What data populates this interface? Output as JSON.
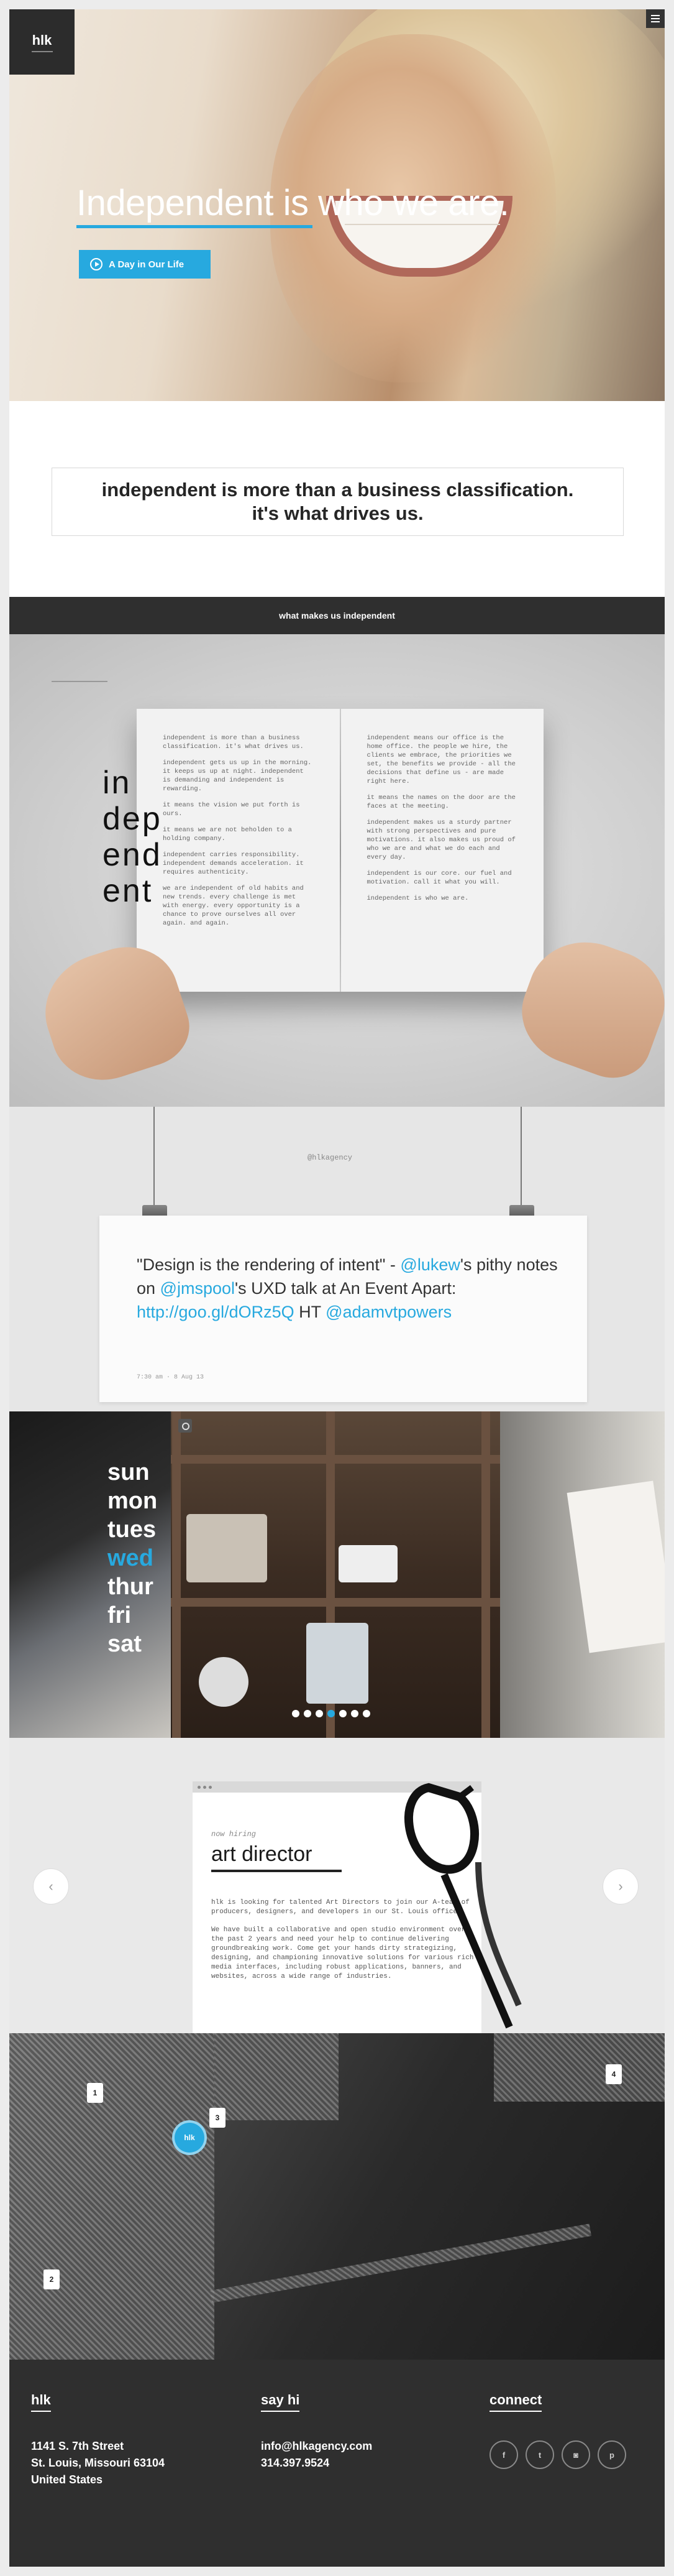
{
  "header": {
    "logo": "hlk",
    "menu_icon": "hamburger-icon"
  },
  "hero": {
    "title": "Independent is who we are.",
    "cta_label": "A Day in Our Life",
    "cta_icon": "play-icon"
  },
  "statement": {
    "line1": "independent is more than a business classification.",
    "line2": "it's what drives us."
  },
  "section_bar": "what makes us independent",
  "book": {
    "big_word": [
      "in",
      "dep",
      "end",
      "ent"
    ],
    "left_page": [
      "independent is more than a business\nclassification. it's what drives us.",
      "independent gets us up in the morning.\nit keeps us up at night. independent\nis demanding and independent is\nrewarding.",
      "it means the vision we put forth is\nours.",
      "it means we are not beholden to a\nholding company.",
      "independent carries responsibility.\nindependent demands acceleration. it\nrequires authenticity.",
      "we are independent of old habits and\nnew trends. every challenge is met\nwith energy. every opportunity is a\nchance to prove ourselves all over\nagain. and again."
    ],
    "right_page": [
      "independent means our office is the\nhome office. the people we hire, the\nclients we embrace, the priorities we\nset, the benefits we provide - all the\ndecisions that define us - are made\nright here.",
      "it means the names on the door are the\nfaces at the meeting.",
      "independent makes us a sturdy partner\nwith strong perspectives and pure\nmotivations. it also makes us proud of\nwho we are and what we do each and\nevery day.",
      "independent is our core. our fuel and\nmotivation. call it what you will.",
      "independent is who we are."
    ]
  },
  "tweet": {
    "handle": "@hlkagency",
    "text_parts": {
      "p1": "\"Design is the rendering of intent\" - ",
      "l1": "@lukew",
      "p2": "'s pithy notes on ",
      "l2": "@jmspool",
      "p3": "'s UXD talk at An Event Apart: ",
      "l3": "http://goo.gl/dORz5Q",
      "p4": "  HT ",
      "l4": "@adamvtpowers"
    },
    "meta": "7:30 am · 8 Aug 13"
  },
  "instagram": {
    "days": [
      "sun",
      "mon",
      "tues",
      "wed",
      "thur",
      "fri",
      "sat"
    ],
    "active_day_index": 3,
    "carousel_dots": 7,
    "active_dot_index": 3,
    "icon": "instagram-icon"
  },
  "job": {
    "kicker": "now hiring",
    "title": "art director",
    "body": [
      "hlk is looking for talented Art Directors to join our A-team of producers, designers, and developers in our St. Louis office.",
      "We have built a collaborative and open studio environment over the past 2 years and need your help to continue delivering groundbreaking work. Come get your hands dirty strategizing, designing, and championing innovative solutions for various rich media interfaces, including robust applications, banners, and websites, across a wide range of industries."
    ],
    "prev_icon": "chevron-left-icon",
    "next_icon": "chevron-right-icon"
  },
  "map": {
    "main_pin": "hlk",
    "pins": [
      "1",
      "2",
      "3",
      "4"
    ]
  },
  "footer": {
    "col1": {
      "title": "hlk",
      "lines": [
        "1141 S. 7th Street",
        "St. Louis, Missouri 63104",
        "United States"
      ]
    },
    "col2": {
      "title": "say hi",
      "lines": [
        "info@hlkagency.com",
        "314.397.9524"
      ]
    },
    "col3": {
      "title": "connect",
      "socials": [
        {
          "icon": "facebook-icon",
          "glyph": "f"
        },
        {
          "icon": "twitter-icon",
          "glyph": "t"
        },
        {
          "icon": "instagram-icon",
          "glyph": "◙"
        },
        {
          "icon": "pinterest-icon",
          "glyph": "p"
        }
      ]
    }
  },
  "colors": {
    "accent": "#27a9df",
    "dark": "#2f2f2f"
  }
}
